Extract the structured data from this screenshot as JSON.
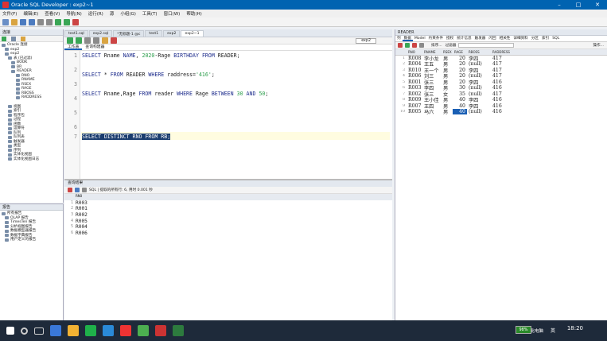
{
  "window": {
    "title": "Oracle SQL Developer : exp2~1"
  },
  "menu": [
    "文件(F)",
    "编辑(E)",
    "查看(V)",
    "导航(N)",
    "运行(R)",
    "源",
    "小组(G)",
    "工具(T)",
    "窗口(W)",
    "帮助(H)"
  ],
  "connections": {
    "header": "连接",
    "items": [
      "Oracle 连接",
      "exp2",
      "表 (已过滤)",
      "BOOK",
      "BR",
      "READER",
      "RNO",
      "RNAME",
      "RSEX",
      "RAGE",
      "RBOSS",
      "RADDRESS",
      "视图",
      "索引",
      "程序包",
      "过程",
      "函数",
      "运算符",
      "队列",
      "队列表",
      "触发器",
      "类型",
      "序列",
      "实体化视图",
      "实体化视图日志"
    ]
  },
  "reports": {
    "header": "报告",
    "items": [
      "所有报告",
      "OLAP 报告",
      "TimesTen 报告",
      "分析视图报告",
      "数据模型器报告",
      "数据字典报告",
      "用户定义的报告"
    ]
  },
  "tabs": [
    "test1.sql",
    "exp2.sql",
    "*无标题-1 @c",
    "test1",
    "exp2",
    "exp2~1"
  ],
  "connection_select": "exp2",
  "subtabs": [
    "工作表",
    "查询构建器"
  ],
  "editor": {
    "line_numbers": [
      "1",
      "2",
      "3",
      "4",
      "5",
      "6",
      "7"
    ]
  },
  "results": {
    "header": "查询结果",
    "status": "SQL | 提取的所有行: 6, 用时 0.001 秒",
    "column": "RNO",
    "rows": [
      "R003",
      "R001",
      "R002",
      "R005",
      "R004",
      "R006"
    ],
    "row_numbers": [
      "1",
      "2",
      "3",
      "4",
      "5",
      "6"
    ]
  },
  "reader_panel": {
    "title": "READER",
    "tabs": [
      "列",
      "数据",
      "Model",
      "约束条件",
      "授权",
      "统计信息",
      "触发器",
      "闪回",
      "相关性",
      "详细资料",
      "分区",
      "索引",
      "SQL"
    ],
    "sort_label": "排序...",
    "filter_label": "过滤器",
    "actions_label": "操作...",
    "columns": [
      "RNO",
      "RNAME",
      "RSEX",
      "RAGE",
      "RBOSS",
      "RADDRESS"
    ],
    "rows": [
      [
        "1",
        "R008",
        "李小龙",
        "男",
        "20",
        "李四",
        "417"
      ],
      [
        "2",
        "R004",
        "王五",
        "男",
        "20",
        "(null)",
        "417"
      ],
      [
        "3",
        "R010",
        "王一个",
        "男",
        "20",
        "李四",
        "417"
      ],
      [
        "4",
        "R006",
        "刘三",
        "男",
        "20",
        "(null)",
        "417"
      ],
      [
        "5",
        "R001",
        "张三",
        "男",
        "20",
        "李四",
        "416"
      ],
      [
        "6",
        "R003",
        "李四",
        "男",
        "30",
        "(null)",
        "416"
      ],
      [
        "7",
        "R002",
        "张三",
        "女",
        "35",
        "(null)",
        "417"
      ],
      [
        "8",
        "R009",
        "王小佳",
        "男",
        "40",
        "李四",
        "416"
      ],
      [
        "9",
        "R007",
        "王四",
        "男",
        "40",
        "李四",
        "416"
      ],
      [
        "10",
        "R005",
        "马六",
        "男",
        "40",
        "(null)",
        "416"
      ]
    ]
  },
  "taskbar": {
    "tray": "此电脑",
    "battery": "98%",
    "ime": "英",
    "time": "18:20"
  }
}
